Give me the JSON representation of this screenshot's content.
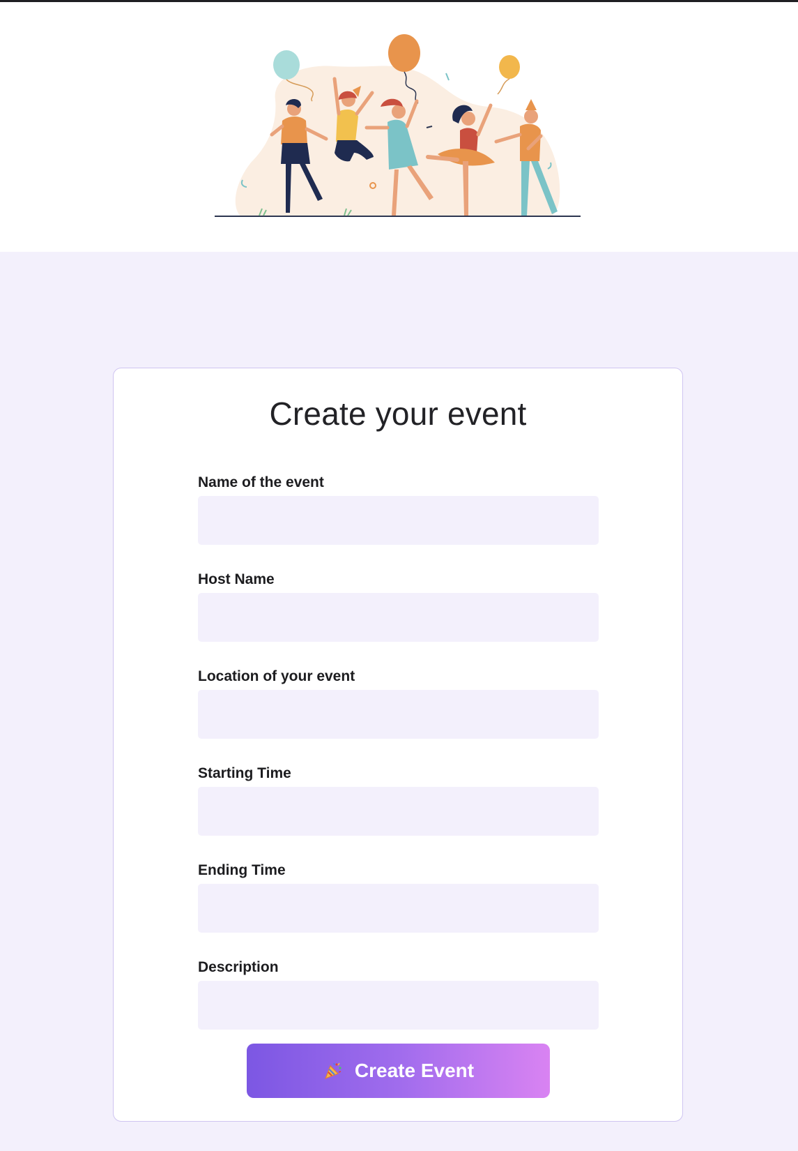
{
  "page": {
    "accent_top_rule": "#1f1f22",
    "background_lower": "#f3f0fc"
  },
  "hero": {
    "illustration": "party-people-dancing-illustration"
  },
  "form": {
    "title": "Create your event",
    "fields": [
      {
        "label": "Name of the event",
        "value": "",
        "placeholder": ""
      },
      {
        "label": "Host Name",
        "value": "",
        "placeholder": ""
      },
      {
        "label": "Location of your event",
        "value": "",
        "placeholder": ""
      },
      {
        "label": "Starting Time",
        "value": "",
        "placeholder": ""
      },
      {
        "label": "Ending Time",
        "value": "",
        "placeholder": ""
      },
      {
        "label": "Description",
        "value": "",
        "placeholder": ""
      }
    ],
    "submit": {
      "icon": "party-popper-icon",
      "label": "Create Event",
      "gradient_start": "#7c57e3",
      "gradient_end": "#d983f2"
    }
  }
}
